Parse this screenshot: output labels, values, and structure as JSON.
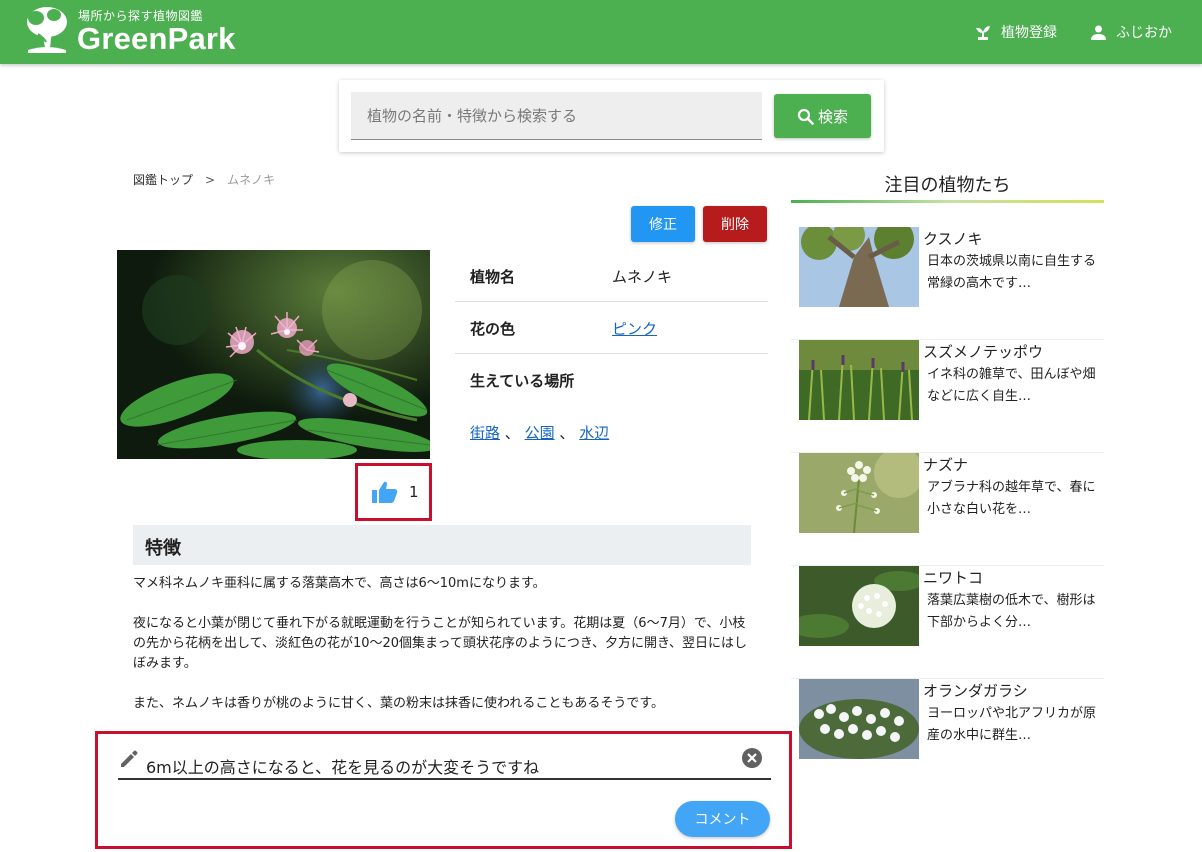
{
  "app": {
    "tagline": "場所から探す植物図鑑",
    "name": "GreenPark"
  },
  "header": {
    "register_label": "植物登録",
    "user_label": "ふじおか"
  },
  "search": {
    "placeholder": "植物の名前・特徴から検索する",
    "value": "",
    "button_label": "検索"
  },
  "breadcrumb": {
    "home": "図鑑トップ",
    "separator": ">",
    "current": "ムネノキ"
  },
  "actions": {
    "edit_label": "修正",
    "delete_label": "削除"
  },
  "plant": {
    "name_label": "植物名",
    "name_value": "ムネノキ",
    "color_label": "花の色",
    "color_value": "ピンク",
    "places_label": "生えている場所",
    "places": [
      "街路",
      "公園",
      "水辺"
    ],
    "places_separator": "、",
    "likes": "1"
  },
  "feature": {
    "title": "特徴",
    "paragraphs": [
      "マメ科ネムノキ亜科に属する落葉高木で、高さは6〜10mになります。",
      "夜になると小葉が閉じて垂れ下がる就眠運動を行うことが知られています。花期は夏（6〜7月）で、小枝の先から花柄を出して、淡紅色の花が10〜20個集まって頭状花序のようにつき、夕方に開き、翌日にはしぼみます。",
      "また、ネムノキは香りが桃のように甘く、葉の粉末は抹香に使われることもあるそうです。"
    ]
  },
  "comment": {
    "value": "6m以上の高さになると、花を見るのが大変そうですね",
    "button_label": "コメント"
  },
  "sidebar": {
    "title": "注目の植物たち",
    "items": [
      {
        "name": "クスノキ",
        "desc": "日本の茨城県以南に自生する常緑の高木です…"
      },
      {
        "name": "スズメノテッポウ",
        "desc": "イネ科の雑草で、田んぼや畑などに広く自生…"
      },
      {
        "name": "ナズナ",
        "desc": "アブラナ科の越年草で、春に小さな白い花を…"
      },
      {
        "name": "ニワトコ",
        "desc": "落葉広葉樹の低木で、樹形は下部からよく分…"
      },
      {
        "name": "オランダガラシ",
        "desc": "ヨーロッパや北アフリカが原産の水中に群生…"
      }
    ]
  },
  "colors": {
    "brand_green": "#4caf50",
    "edit_blue": "#2196f3",
    "delete_red": "#b71c1c",
    "highlight_red": "#c8102e",
    "link_blue": "#1565c0",
    "comment_blue": "#42a5f5"
  },
  "icons": {
    "logo": "tree-logo-icon",
    "register": "sprout-icon",
    "user": "person-icon",
    "search": "search-icon",
    "like": "thumbs-up-icon",
    "pencil": "pencil-icon",
    "clear": "clear-circle-icon"
  }
}
